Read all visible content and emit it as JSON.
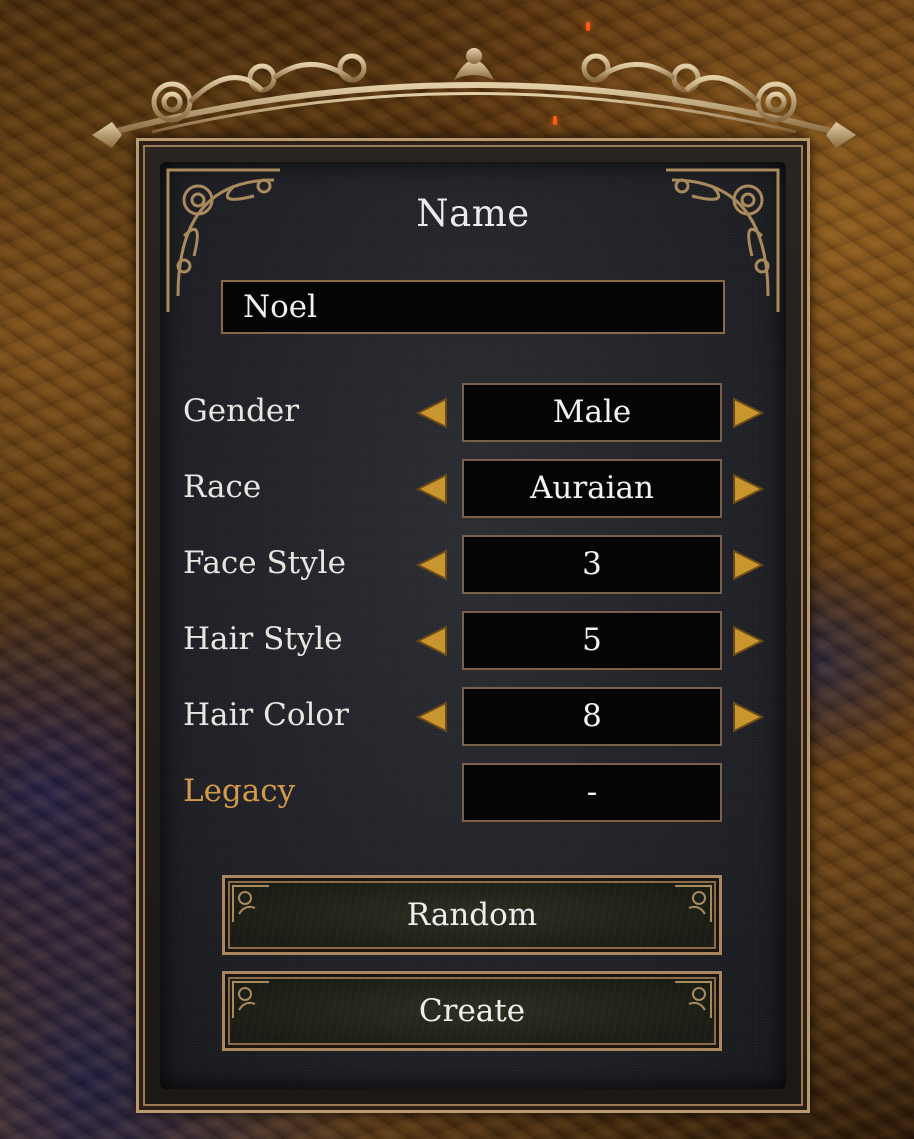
{
  "form": {
    "title": "Name",
    "name_value": "Noel"
  },
  "attributes": [
    {
      "label": "Gender",
      "value": "Male"
    },
    {
      "label": "Race",
      "value": "Auraian"
    },
    {
      "label": "Face Style",
      "value": "3"
    },
    {
      "label": "Hair Style",
      "value": "5"
    },
    {
      "label": "Hair Color",
      "value": "8"
    }
  ],
  "legacy": {
    "label": "Legacy",
    "value": "-"
  },
  "buttons": {
    "random": "Random",
    "create": "Create"
  },
  "colors": {
    "gold_accent": "#c9952e",
    "legacy_label": "#d39a4a",
    "frame_border": "#b99a6e",
    "panel_bg": "#1e1f24"
  },
  "icons": {
    "prev": "triangle-left-icon",
    "next": "triangle-right-icon"
  }
}
